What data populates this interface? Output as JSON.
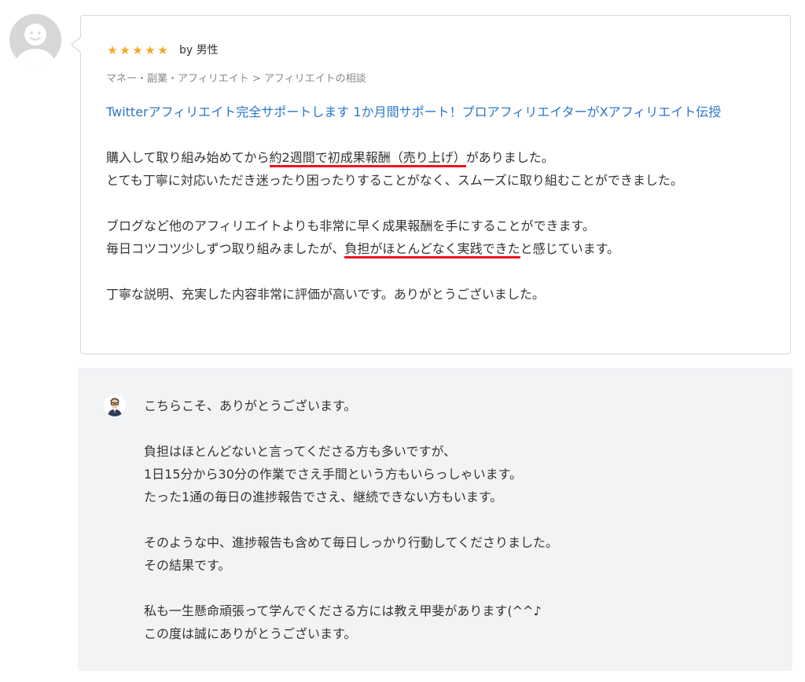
{
  "review": {
    "rating": 5,
    "stars": [
      "★",
      "★",
      "★",
      "★",
      "★"
    ],
    "reviewer": "by 男性",
    "category": "マネー・副業・アフィリエイト > アフィリエイトの相談",
    "service_title": "Twitterアフィリエイト完全サポートします 1か月間サポート！プロアフィリエイターがXアフィリエイト伝授",
    "body": {
      "line1_pre": "購入して取り組み始めてから",
      "line1_highlight": "約2週間で初成果報酬（売り上げ）",
      "line1_post": "がありました。",
      "line2": "とても丁寧に対応いただき迷ったり困ったりすることがなく、スムーズに取り組むことができました。",
      "line3": "ブログなど他のアフィリエイトよりも非常に早く成果報酬を手にすることができます。",
      "line4_pre": "毎日コツコツ少しずつ取り組みましたが、",
      "line4_highlight": "負担がほとんどなく実践できた",
      "line4_post": "と感じています。",
      "line5": "丁寧な説明、充実した内容非常に評価が高いです。ありがとうございました。"
    }
  },
  "reply": {
    "lines": [
      "こちらこそ、ありがとうございます。",
      "",
      "負担はほとんどないと言ってくださる方も多いですが、",
      "1日15分から30分の作業でさえ手間という方もいらっしゃいます。",
      "たった1通の毎日の進捗報告でさえ、継続できない方もいます。",
      "",
      "そのような中、進捗報告も含めて毎日しっかり行動してくださりました。",
      "その結果です。",
      "",
      "私も一生懸命頑張って学んでくださる方には教え甲斐があります(^^♪",
      "この度は誠にありがとうございます。"
    ]
  },
  "colors": {
    "star": "#f5a623",
    "link": "#2a77c9",
    "highlight_underline": "#e8161f",
    "reply_background": "#f2f3f5"
  }
}
